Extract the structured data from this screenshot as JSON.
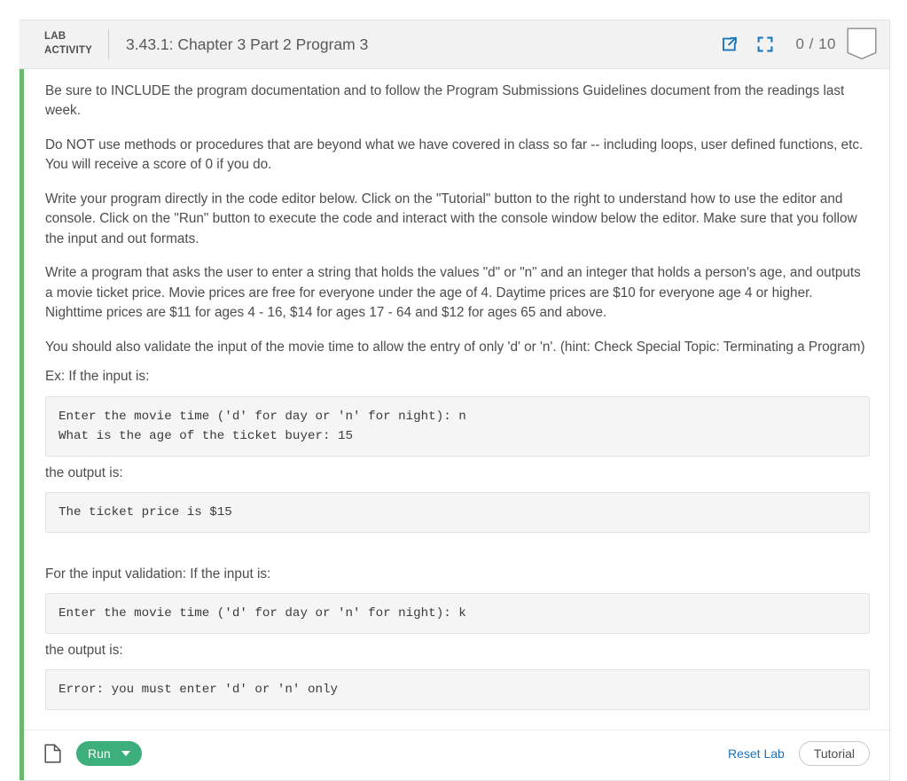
{
  "header": {
    "lab_tag_line1": "LAB",
    "lab_tag_line2": "ACTIVITY",
    "title": "3.43.1: Chapter 3 Part 2 Program 3",
    "open_in_new_icon": "external-link-icon",
    "fullscreen_icon": "fullscreen-icon",
    "score": "0 / 10",
    "ribbon_icon": "ribbon-badge-icon",
    "accent_color": "#6ab96f",
    "icon_color": "#1b75bb",
    "background_color": "#f2f2f2"
  },
  "body": {
    "paragraphs": [
      "Be sure to INCLUDE the program documentation and to follow the Program Submissions Guidelines document from the readings last week.",
      "Do NOT use methods or procedures that are beyond what we have covered in class so far -- including loops, user defined functions, etc. You will receive a score of 0 if you do.",
      "Write your program directly in the code editor below. Click on the \"Tutorial\" button to the right to understand how to use the editor and console. Click on the \"Run\" button to execute the code and interact with the console window below the editor. Make sure that you follow the input and out formats.",
      "Write a program that asks the user to enter a string that holds the values \"d\" or \"n\" and an integer that holds a person's age, and outputs a movie ticket price. Movie prices are free for everyone under the age of 4. Daytime prices are $10 for everyone age 4 or higher. Nighttime prices are $11 for ages 4 - 16, $14 for ages 17 - 64 and $12 for ages 65 and above.",
      "You should also validate the input of the movie time to allow the entry of only 'd' or 'n'. (hint: Check Special Topic: Terminating a Program)"
    ],
    "example_label": "Ex: If the input is:",
    "example_input": "Enter the movie time ('d' for day or 'n' for night): n\nWhat is the age of the ticket buyer: 15",
    "output_label_1": "the output is:",
    "example_output": "The ticket price is $15",
    "validation_label": "For the input validation: If the input is:",
    "validation_input": "Enter the movie time ('d' for day or 'n' for night): k",
    "output_label_2": "the output is:",
    "validation_output": "Error: you must enter 'd' or 'n' only"
  },
  "toolbar": {
    "file_icon": "file-icon",
    "run_label": "Run",
    "reset_label": "Reset Lab",
    "tutorial_label": "Tutorial",
    "run_color": "#3daf7d",
    "link_color": "#1b75bb"
  }
}
